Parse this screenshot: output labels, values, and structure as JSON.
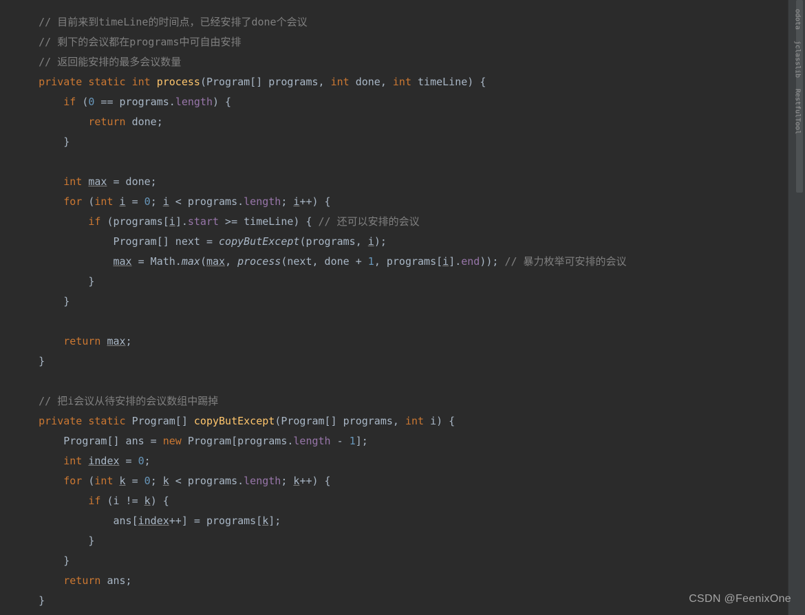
{
  "code": {
    "lines": [
      {
        "indent": 1,
        "tokens": [
          {
            "t": "comment",
            "v": "// 目前来到timeLine的时间点，已经安排了done个会议"
          }
        ]
      },
      {
        "indent": 1,
        "tokens": [
          {
            "t": "comment",
            "v": "// 剩下的会议都在programs中可自由安排"
          }
        ]
      },
      {
        "indent": 1,
        "tokens": [
          {
            "t": "comment",
            "v": "// 返回能安排的最多会议数量"
          }
        ]
      },
      {
        "indent": 1,
        "tokens": [
          {
            "t": "keyword",
            "v": "private static int "
          },
          {
            "t": "method-decl",
            "v": "process"
          },
          {
            "t": "paren",
            "v": "(Program[] programs, "
          },
          {
            "t": "keyword",
            "v": "int "
          },
          {
            "t": "paren",
            "v": "done, "
          },
          {
            "t": "keyword",
            "v": "int "
          },
          {
            "t": "paren",
            "v": "timeLine) {"
          }
        ]
      },
      {
        "indent": 2,
        "tokens": [
          {
            "t": "keyword",
            "v": "if "
          },
          {
            "t": "paren",
            "v": "("
          },
          {
            "t": "number",
            "v": "0"
          },
          {
            "t": "paren",
            "v": " == programs."
          },
          {
            "t": "field",
            "v": "length"
          },
          {
            "t": "paren",
            "v": ") {"
          }
        ]
      },
      {
        "indent": 3,
        "tokens": [
          {
            "t": "keyword",
            "v": "return "
          },
          {
            "t": "paren",
            "v": "done;"
          }
        ]
      },
      {
        "indent": 2,
        "tokens": [
          {
            "t": "paren",
            "v": "}"
          }
        ]
      },
      {
        "indent": 0,
        "tokens": [
          {
            "t": "paren",
            "v": ""
          }
        ]
      },
      {
        "indent": 2,
        "tokens": [
          {
            "t": "keyword",
            "v": "int "
          },
          {
            "t": "underline",
            "v": "max"
          },
          {
            "t": "paren",
            "v": " = done;"
          }
        ]
      },
      {
        "indent": 2,
        "tokens": [
          {
            "t": "keyword",
            "v": "for "
          },
          {
            "t": "paren",
            "v": "("
          },
          {
            "t": "keyword",
            "v": "int "
          },
          {
            "t": "underline",
            "v": "i"
          },
          {
            "t": "paren",
            "v": " = "
          },
          {
            "t": "number",
            "v": "0"
          },
          {
            "t": "paren",
            "v": "; "
          },
          {
            "t": "underline",
            "v": "i"
          },
          {
            "t": "paren",
            "v": " < programs."
          },
          {
            "t": "field",
            "v": "length"
          },
          {
            "t": "paren",
            "v": "; "
          },
          {
            "t": "underline",
            "v": "i"
          },
          {
            "t": "paren",
            "v": "++) {"
          }
        ]
      },
      {
        "indent": 3,
        "tokens": [
          {
            "t": "keyword",
            "v": "if "
          },
          {
            "t": "paren",
            "v": "(programs["
          },
          {
            "t": "underline",
            "v": "i"
          },
          {
            "t": "paren",
            "v": "]."
          },
          {
            "t": "field",
            "v": "start"
          },
          {
            "t": "paren",
            "v": " >= timeLine) { "
          },
          {
            "t": "comment",
            "v": "// 还可以安排的会议"
          }
        ]
      },
      {
        "indent": 4,
        "tokens": [
          {
            "t": "paren",
            "v": "Program[] next = "
          },
          {
            "t": "method-call-italic",
            "v": "copyButExcept"
          },
          {
            "t": "paren",
            "v": "(programs, "
          },
          {
            "t": "underline",
            "v": "i"
          },
          {
            "t": "paren",
            "v": ");"
          }
        ]
      },
      {
        "indent": 4,
        "tokens": [
          {
            "t": "underline",
            "v": "max"
          },
          {
            "t": "paren",
            "v": " = Math."
          },
          {
            "t": "method-call-italic",
            "v": "max"
          },
          {
            "t": "paren",
            "v": "("
          },
          {
            "t": "underline",
            "v": "max"
          },
          {
            "t": "paren",
            "v": ", "
          },
          {
            "t": "method-call-italic",
            "v": "process"
          },
          {
            "t": "paren",
            "v": "(next, done + "
          },
          {
            "t": "number",
            "v": "1"
          },
          {
            "t": "paren",
            "v": ", programs["
          },
          {
            "t": "underline",
            "v": "i"
          },
          {
            "t": "paren",
            "v": "]."
          },
          {
            "t": "field",
            "v": "end"
          },
          {
            "t": "paren",
            "v": ")); "
          },
          {
            "t": "comment",
            "v": "// 暴力枚举可安排的会议"
          }
        ]
      },
      {
        "indent": 3,
        "tokens": [
          {
            "t": "paren",
            "v": "}"
          }
        ]
      },
      {
        "indent": 2,
        "tokens": [
          {
            "t": "paren",
            "v": "}"
          }
        ]
      },
      {
        "indent": 0,
        "tokens": [
          {
            "t": "paren",
            "v": ""
          }
        ]
      },
      {
        "indent": 2,
        "tokens": [
          {
            "t": "keyword",
            "v": "return "
          },
          {
            "t": "underline",
            "v": "max"
          },
          {
            "t": "paren",
            "v": ";"
          }
        ]
      },
      {
        "indent": 1,
        "tokens": [
          {
            "t": "paren",
            "v": "}"
          }
        ]
      },
      {
        "indent": 0,
        "tokens": [
          {
            "t": "paren",
            "v": ""
          }
        ]
      },
      {
        "indent": 1,
        "tokens": [
          {
            "t": "comment",
            "v": "// 把i会议从待安排的会议数组中踢掉"
          }
        ]
      },
      {
        "indent": 1,
        "tokens": [
          {
            "t": "keyword",
            "v": "private static "
          },
          {
            "t": "paren",
            "v": "Program[] "
          },
          {
            "t": "method-decl",
            "v": "copyButExcept"
          },
          {
            "t": "paren",
            "v": "(Program[] programs, "
          },
          {
            "t": "keyword",
            "v": "int "
          },
          {
            "t": "paren",
            "v": "i) {"
          }
        ]
      },
      {
        "indent": 2,
        "tokens": [
          {
            "t": "paren",
            "v": "Program[] ans = "
          },
          {
            "t": "keyword",
            "v": "new "
          },
          {
            "t": "paren",
            "v": "Program[programs."
          },
          {
            "t": "field",
            "v": "length"
          },
          {
            "t": "paren",
            "v": " - "
          },
          {
            "t": "number",
            "v": "1"
          },
          {
            "t": "paren",
            "v": "];"
          }
        ]
      },
      {
        "indent": 2,
        "tokens": [
          {
            "t": "keyword",
            "v": "int "
          },
          {
            "t": "underline",
            "v": "index"
          },
          {
            "t": "paren",
            "v": " = "
          },
          {
            "t": "number",
            "v": "0"
          },
          {
            "t": "paren",
            "v": ";"
          }
        ]
      },
      {
        "indent": 2,
        "tokens": [
          {
            "t": "keyword",
            "v": "for "
          },
          {
            "t": "paren",
            "v": "("
          },
          {
            "t": "keyword",
            "v": "int "
          },
          {
            "t": "underline",
            "v": "k"
          },
          {
            "t": "paren",
            "v": " = "
          },
          {
            "t": "number",
            "v": "0"
          },
          {
            "t": "paren",
            "v": "; "
          },
          {
            "t": "underline",
            "v": "k"
          },
          {
            "t": "paren",
            "v": " < programs."
          },
          {
            "t": "field",
            "v": "length"
          },
          {
            "t": "paren",
            "v": "; "
          },
          {
            "t": "underline",
            "v": "k"
          },
          {
            "t": "paren",
            "v": "++) {"
          }
        ]
      },
      {
        "indent": 3,
        "tokens": [
          {
            "t": "keyword",
            "v": "if "
          },
          {
            "t": "paren",
            "v": "(i != "
          },
          {
            "t": "underline",
            "v": "k"
          },
          {
            "t": "paren",
            "v": ") {"
          }
        ]
      },
      {
        "indent": 4,
        "tokens": [
          {
            "t": "paren",
            "v": "ans["
          },
          {
            "t": "underline",
            "v": "index"
          },
          {
            "t": "paren",
            "v": "++] = programs["
          },
          {
            "t": "underline",
            "v": "k"
          },
          {
            "t": "paren",
            "v": "];"
          }
        ]
      },
      {
        "indent": 3,
        "tokens": [
          {
            "t": "paren",
            "v": "}"
          }
        ]
      },
      {
        "indent": 2,
        "tokens": [
          {
            "t": "paren",
            "v": "}"
          }
        ]
      },
      {
        "indent": 2,
        "tokens": [
          {
            "t": "keyword",
            "v": "return "
          },
          {
            "t": "paren",
            "v": "ans;"
          }
        ]
      },
      {
        "indent": 1,
        "tokens": [
          {
            "t": "paren",
            "v": "}"
          }
        ]
      }
    ]
  },
  "sideTabs": [
    {
      "label": "odota"
    },
    {
      "label": "jclasslib"
    },
    {
      "label": "RestfulTool"
    }
  ],
  "watermark": "CSDN @FeenixOne",
  "indentUnit": "    "
}
